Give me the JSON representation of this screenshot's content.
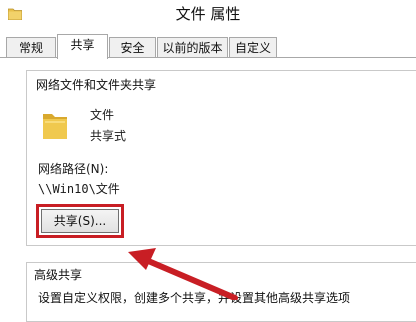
{
  "window": {
    "title": "文件 属性"
  },
  "tabs": [
    {
      "label": "常规",
      "active": false
    },
    {
      "label": "共享",
      "active": true
    },
    {
      "label": "安全",
      "active": false
    },
    {
      "label": "以前的版本",
      "active": false
    },
    {
      "label": "自定义",
      "active": false
    }
  ],
  "network_share": {
    "group_title": "网络文件和文件夹共享",
    "file_name": "文件",
    "share_state": "共享式",
    "path_label": "网络路径(N):",
    "path_value": "\\\\Win10\\文件",
    "share_button_label": "共享(S)..."
  },
  "advanced_share": {
    "group_title": "高级共享",
    "description": "设置自定义权限，创建多个共享，并设置其他高级共享选项"
  },
  "colors": {
    "highlight": "#c81e24",
    "arrow": "#c81e24",
    "folder": "#e8c04a"
  },
  "icons": {
    "title": "folder-icon",
    "file": "folder-icon"
  }
}
